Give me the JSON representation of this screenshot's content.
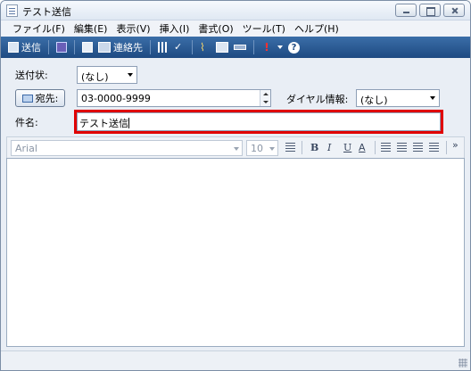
{
  "window": {
    "title": "テスト送信"
  },
  "menu": [
    "ファイル(F)",
    "編集(E)",
    "表示(V)",
    "挿入(I)",
    "書式(O)",
    "ツール(T)",
    "ヘルプ(H)"
  ],
  "toolbar": {
    "send_label": "送信",
    "contacts_label": "連絡先"
  },
  "form": {
    "cover_label": "送付状:",
    "cover_value": "(なし)",
    "to_button_label": "宛先:",
    "to_value": "03-0000-9999",
    "dial_label": "ダイヤル情報:",
    "dial_value": "(なし)",
    "subject_label": "件名:",
    "subject_value": "テスト送信"
  },
  "format": {
    "font_name": "Arial",
    "font_size": "10",
    "bold": "B",
    "italic": "I",
    "underline": "U",
    "font_color": "A",
    "more": "»"
  },
  "colors": {
    "highlight": "#e00000",
    "toolbar": "#2a5a94"
  }
}
